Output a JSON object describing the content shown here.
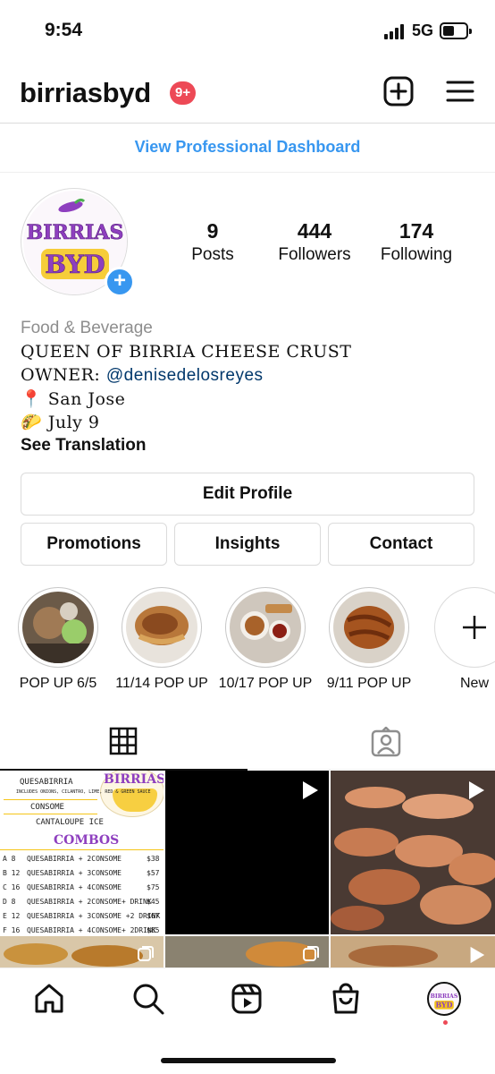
{
  "status_bar": {
    "time": "9:54",
    "network": "5G"
  },
  "header": {
    "username": "birriasbyd",
    "notification_count": "9+"
  },
  "dashboard_link": "View Professional Dashboard",
  "profile": {
    "avatar_text_line1": "BIRRIAS",
    "avatar_text_line2": "BYD",
    "stats": [
      {
        "value": "9",
        "label": "Posts"
      },
      {
        "value": "444",
        "label": "Followers"
      },
      {
        "value": "174",
        "label": "Following"
      }
    ],
    "category": "Food & Beverage",
    "bio_line1": "QUEEN OF BIRRIA CHEESE CRUST",
    "owner_prefix": "OWNER: ",
    "owner_handle": "@denisedelosreyes",
    "location_icon": "📍",
    "location": "San Jose",
    "date_icon": "🌮",
    "date": "July 9",
    "see_translation": "See Translation"
  },
  "buttons": {
    "edit_profile": "Edit Profile",
    "promotions": "Promotions",
    "insights": "Insights",
    "contact": "Contact"
  },
  "highlights": [
    {
      "label": "POP UP 6/5"
    },
    {
      "label": "11/14 POP UP"
    },
    {
      "label": "10/17 POP UP"
    },
    {
      "label": "9/11 POP UP"
    },
    {
      "label": "New"
    }
  ],
  "menu_post": {
    "logo_text": "BIRRIAS",
    "items": [
      "QUESABIRRIA",
      "INCLUDES ONIONS, CILANTRO, LIME, RED & GREEN SAUCE",
      "CONSOME",
      "CANTALOUPE ICE"
    ],
    "combos_title": "COMBOS",
    "combos": [
      {
        "code": "A 8",
        "desc": "QUESABIRRIA + 2CONSOME",
        "price": "$38"
      },
      {
        "code": "B 12",
        "desc": "QUESABIRRIA + 3CONSOME",
        "price": "$57"
      },
      {
        "code": "C 16",
        "desc": "QUESABIRRIA + 4CONSOME",
        "price": "$75"
      },
      {
        "code": "D 8",
        "desc": "QUESABIRRIA + 2CONSOME+ DRINK",
        "price": "$45"
      },
      {
        "code": "E 12",
        "desc": "QUESABIRRIA + 3CONSOME +2 DRINK",
        "price": "$67"
      },
      {
        "code": "F 16",
        "desc": "QUESABIRRIA + 4CONSOME+ 2DRINK",
        "price": "$85"
      }
    ]
  },
  "colors": {
    "accent_blue": "#3897f0",
    "badge_red": "#ed4956",
    "border_gray": "#dbdbdb",
    "muted_text": "#8e8e8e",
    "logo_purple": "#8e3fbf",
    "logo_yellow": "#f5c518"
  },
  "icons": {
    "create": "plus-square-icon",
    "menu": "hamburger-menu-icon",
    "grid_tab": "grid-icon",
    "tagged_tab": "tagged-person-icon",
    "home": "home-icon",
    "search": "search-icon",
    "reels": "reels-icon",
    "shop": "shopping-bag-icon",
    "reel_badge": "play-icon"
  }
}
